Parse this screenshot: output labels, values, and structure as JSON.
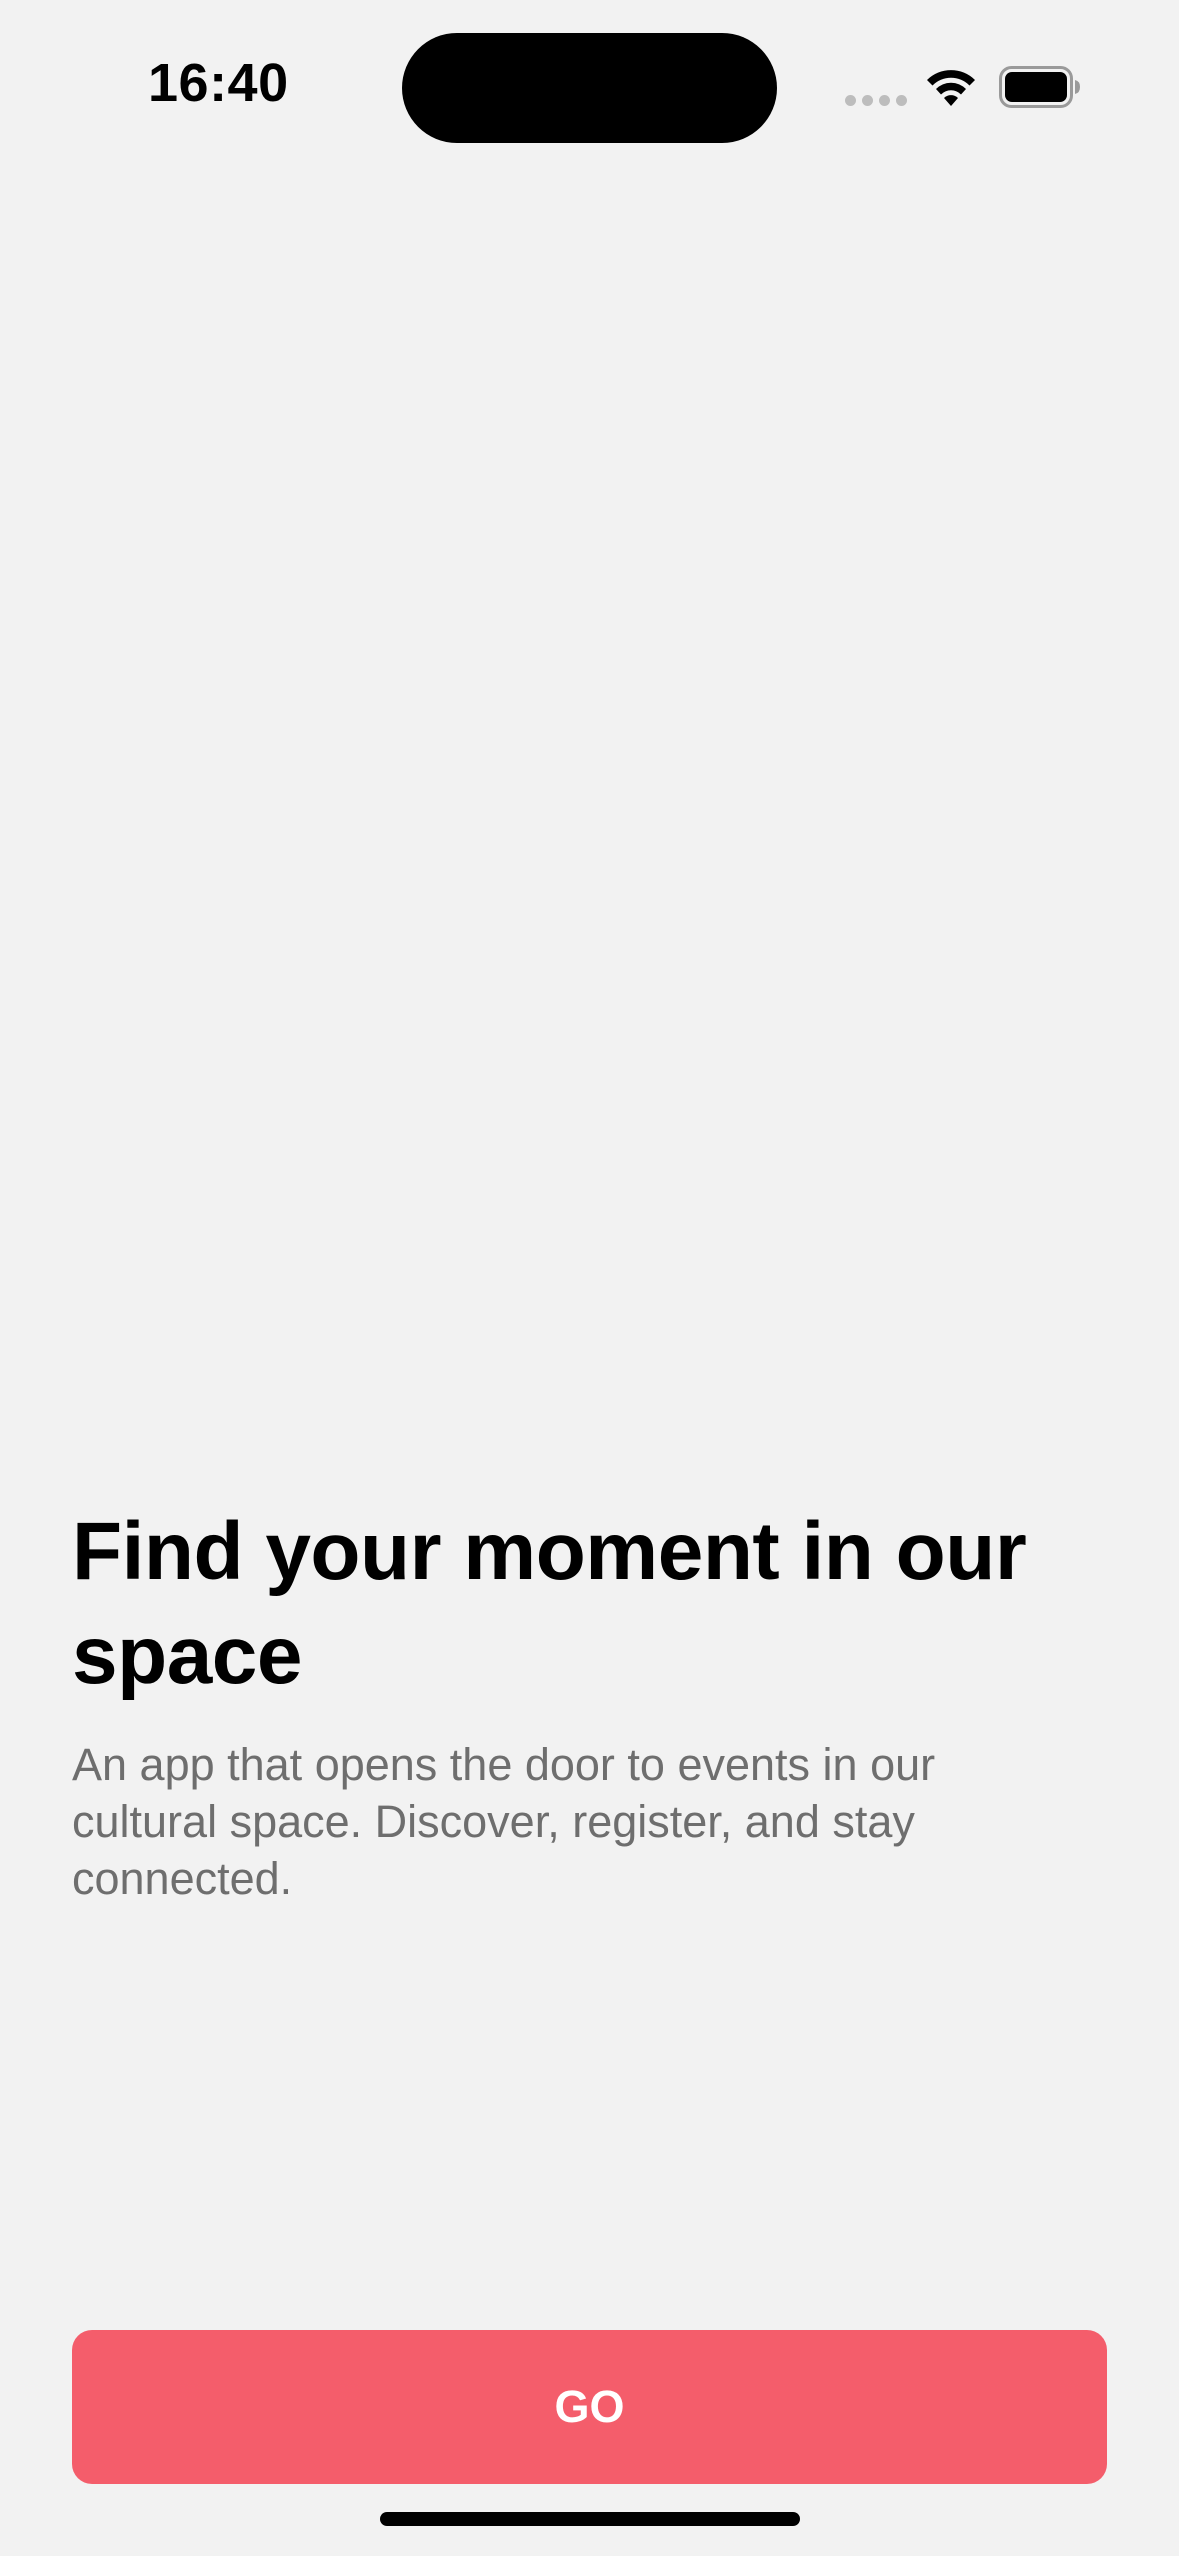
{
  "status_bar": {
    "time": "16:40",
    "icons": [
      "cellular-signal-icon",
      "wifi-icon",
      "battery-icon"
    ]
  },
  "onboarding": {
    "title": "Find your moment in our space",
    "description": "An app that opens the door to events in our cultural space. Discover, register, and stay connected.",
    "cta_label": "GO"
  },
  "colors": {
    "background": "#f2f2f2",
    "accent": "#f45d6b",
    "title_text": "#000000",
    "description_text": "#6e6e6e"
  }
}
